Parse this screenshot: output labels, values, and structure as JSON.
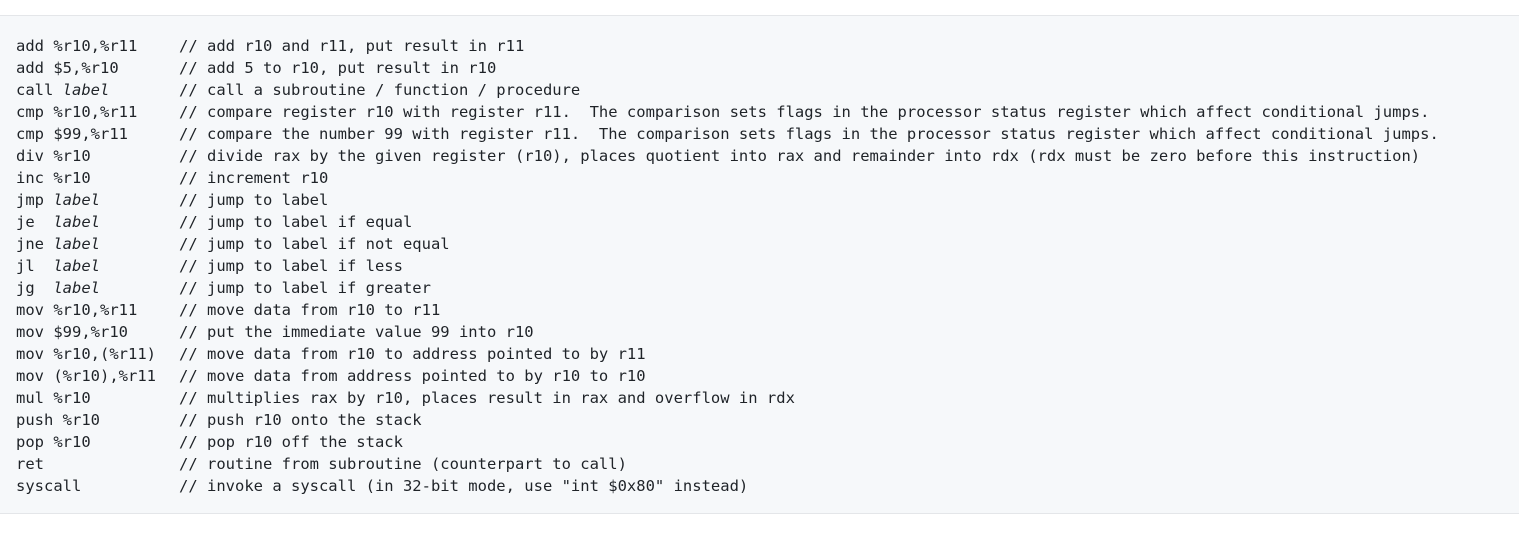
{
  "lines": [
    {
      "op": "add ",
      "arg": "%r10,%r11",
      "arg_italic": false,
      "comment": "// add r10 and r11, put result in r11"
    },
    {
      "op": "add ",
      "arg": "$5,%r10",
      "arg_italic": false,
      "comment": "// add 5 to r10, put result in r10"
    },
    {
      "op": "call ",
      "arg": "label",
      "arg_italic": true,
      "comment": "// call a subroutine / function / procedure"
    },
    {
      "op": "cmp ",
      "arg": "%r10,%r11",
      "arg_italic": false,
      "comment": "// compare register r10 with register r11.  The comparison sets flags in the processor status register which affect conditional jumps."
    },
    {
      "op": "cmp ",
      "arg": "$99,%r11",
      "arg_italic": false,
      "comment": "// compare the number 99 with register r11.  The comparison sets flags in the processor status register which affect conditional jumps."
    },
    {
      "op": "div ",
      "arg": "%r10",
      "arg_italic": false,
      "comment": "// divide rax by the given register (r10), places quotient into rax and remainder into rdx (rdx must be zero before this instruction)"
    },
    {
      "op": "inc ",
      "arg": "%r10",
      "arg_italic": false,
      "comment": "// increment r10"
    },
    {
      "op": "jmp ",
      "arg": "label",
      "arg_italic": true,
      "comment": "// jump to label"
    },
    {
      "op": "je  ",
      "arg": "label",
      "arg_italic": true,
      "comment": "// jump to label if equal"
    },
    {
      "op": "jne ",
      "arg": "label",
      "arg_italic": true,
      "comment": "// jump to label if not equal"
    },
    {
      "op": "jl  ",
      "arg": "label",
      "arg_italic": true,
      "comment": "// jump to label if less"
    },
    {
      "op": "jg  ",
      "arg": "label",
      "arg_italic": true,
      "comment": "// jump to label if greater"
    },
    {
      "op": "mov ",
      "arg": "%r10,%r11",
      "arg_italic": false,
      "comment": "// move data from r10 to r11"
    },
    {
      "op": "mov ",
      "arg": "$99,%r10",
      "arg_italic": false,
      "comment": "// put the immediate value 99 into r10"
    },
    {
      "op": "mov ",
      "arg": "%r10,(%r11)",
      "arg_italic": false,
      "comment": "// move data from r10 to address pointed to by r11"
    },
    {
      "op": "mov ",
      "arg": "(%r10),%r11",
      "arg_italic": false,
      "comment": "// move data from address pointed to by r10 to r10"
    },
    {
      "op": "mul ",
      "arg": "%r10",
      "arg_italic": false,
      "comment": "// multiplies rax by r10, places result in rax and overflow in rdx"
    },
    {
      "op": "push ",
      "arg": "%r10",
      "arg_italic": false,
      "comment": "// push r10 onto the stack"
    },
    {
      "op": "pop ",
      "arg": "%r10",
      "arg_italic": false,
      "comment": "// pop r10 off the stack"
    },
    {
      "op": "ret",
      "arg": "",
      "arg_italic": false,
      "comment": "// routine from subroutine (counterpart to call)"
    },
    {
      "op": "syscall",
      "arg": "",
      "arg_italic": false,
      "comment": "// invoke a syscall (in 32-bit mode, use \"int $0x80\" instead)"
    }
  ],
  "colors": {
    "background": "#f6f8fa",
    "text": "#1f2328",
    "border": "#e4e6e9"
  }
}
